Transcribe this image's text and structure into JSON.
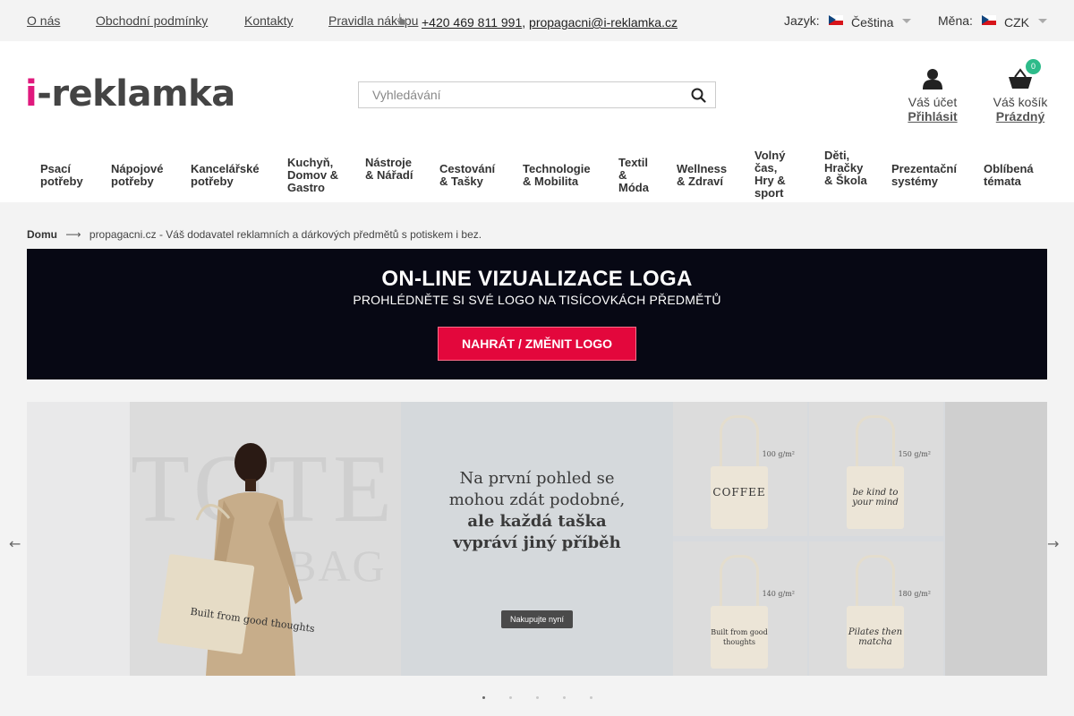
{
  "topbar": {
    "links": [
      "O nás",
      "Obchodní podmínky",
      "Kontakty",
      "Pravidla nákupu"
    ],
    "phone": "+420 469 811 991",
    "email": "propagacni@i-reklamka.cz",
    "separator": ",",
    "language_label": "Jazyk:",
    "language_value": "Čeština",
    "currency_label": "Měna:",
    "currency_value": "CZK"
  },
  "header": {
    "logo_i": "i",
    "logo_rest": "-reklamka",
    "search_placeholder": "Vyhledávání",
    "account_label": "Váš účet",
    "account_link": "Přihlásit",
    "cart_label": "Váš košík",
    "cart_status": "Prázdný",
    "cart_count": "0"
  },
  "nav": [
    "Psací potřeby",
    "Nápojové potřeby",
    "Kancelářské potřeby",
    "Kuchyň, Domov & Gastro",
    "Nástroje & Nářadí",
    "Cestování & Tašky",
    "Technologie & Mobilita",
    "Textil & Móda",
    "Wellness & Zdraví",
    "Volný čas, Hry & sport",
    "Děti, Hračky & Škola",
    "Prezentační systémy",
    "Oblíbená témata"
  ],
  "breadcrumb": {
    "home": "Domu",
    "arrow": "⟶",
    "current": "propagacni.cz - Váš dodavatel reklamních a dárkových předmětů s potiskem i bez."
  },
  "promo": {
    "title": "ON-LINE VIZUALIZACE LOGA",
    "subtitle": "PROHLÉDNĚTE SI SVÉ LOGO NA TISÍCOVKÁCH PŘEDMĚTŮ",
    "button": "NAHRÁT / ZMĚNIT LOGO"
  },
  "slider": {
    "bg_word_1": "TOTE",
    "bg_word_2": "BAG",
    "model_bag_text": "Built from good thoughts",
    "headline_1": "Na první pohled se",
    "headline_2": "mohou zdát podobné,",
    "headline_3": "ale každá taška",
    "headline_4": "vypráví jiný příběh",
    "shop_button": "Nakupujte nyní",
    "tiles": [
      {
        "weight": "100 g/m²",
        "print": "COFFEE"
      },
      {
        "weight": "150 g/m²",
        "print": "be kind to your mind"
      },
      {
        "weight": "140 g/m²",
        "print": "Built from good thoughts"
      },
      {
        "weight": "180 g/m²",
        "print": "Pilates then matcha"
      }
    ],
    "prev": "←",
    "next": "→",
    "dot_count": 5,
    "active_dot": 0
  },
  "colors": {
    "brand_pink": "#e0197d",
    "promo_bg": "#070814",
    "promo_button": "#e3073c",
    "cart_badge": "#2dbb8a"
  }
}
